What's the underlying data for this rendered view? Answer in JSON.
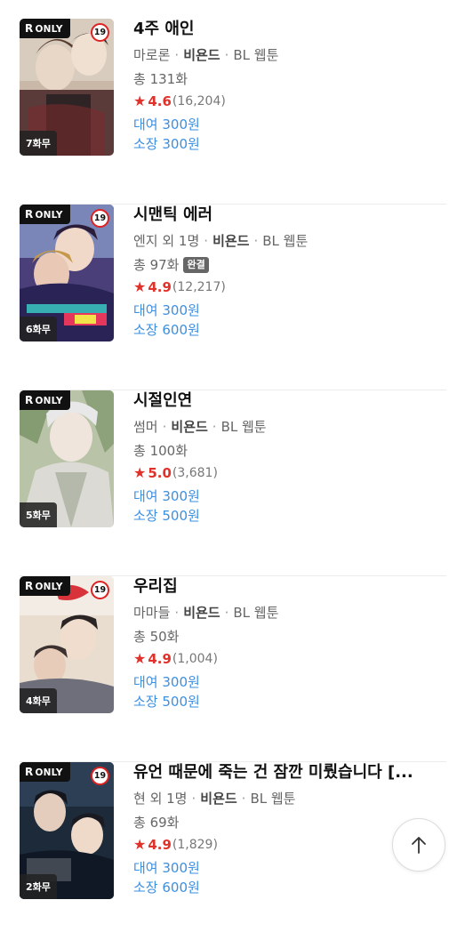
{
  "items": [
    {
      "title": "4주 애인",
      "author": "마로론",
      "publisher": "비욘드",
      "genre": "BL 웹툰",
      "episodes": "총 131화",
      "badge": "",
      "rating": "4.6",
      "rating_count": "(16,204)",
      "rent": "대여 300원",
      "own": "소장 300원",
      "cover_label": "ONLY",
      "cover_r": "R",
      "age": "19",
      "free_wait": "7화무"
    },
    {
      "title": "시맨틱 에러",
      "author": "엔지 외 1명",
      "publisher": "비욘드",
      "genre": "BL 웹툰",
      "episodes": "총 97화",
      "badge": "완결",
      "rating": "4.9",
      "rating_count": "(12,217)",
      "rent": "대여 300원",
      "own": "소장 600원",
      "cover_label": "ONLY",
      "cover_r": "R",
      "age": "19",
      "free_wait": "6화무"
    },
    {
      "title": "시절인연",
      "author": "썸머",
      "publisher": "비욘드",
      "genre": "BL 웹툰",
      "episodes": "총 100화",
      "badge": "",
      "rating": "5.0",
      "rating_count": "(3,681)",
      "rent": "대여 300원",
      "own": "소장 500원",
      "cover_label": "ONLY",
      "cover_r": "R",
      "age": "",
      "free_wait": "5화무"
    },
    {
      "title": "우리집",
      "author": "마마들",
      "publisher": "비욘드",
      "genre": "BL 웹툰",
      "episodes": "총 50화",
      "badge": "",
      "rating": "4.9",
      "rating_count": "(1,004)",
      "rent": "대여 300원",
      "own": "소장 500원",
      "cover_label": "ONLY",
      "cover_r": "R",
      "age": "19",
      "free_wait": "4화무"
    },
    {
      "title": "유언 때문에 죽는 건 잠깐 미뤘습니다 [...",
      "author": "현 외 1명",
      "publisher": "비욘드",
      "genre": "BL 웹툰",
      "episodes": "총 69화",
      "badge": "",
      "rating": "4.9",
      "rating_count": "(1,829)",
      "rent": "대여 300원",
      "own": "소장 600원",
      "cover_label": "ONLY",
      "cover_r": "R",
      "age": "19",
      "free_wait": "2화무"
    }
  ],
  "separator": "·",
  "star_icon": "star-icon",
  "scroll_top_icon": "arrow-up-icon",
  "colors": {
    "rating": "#e0322b",
    "price": "#3d8fe0",
    "age_ring": "#dd2222"
  }
}
